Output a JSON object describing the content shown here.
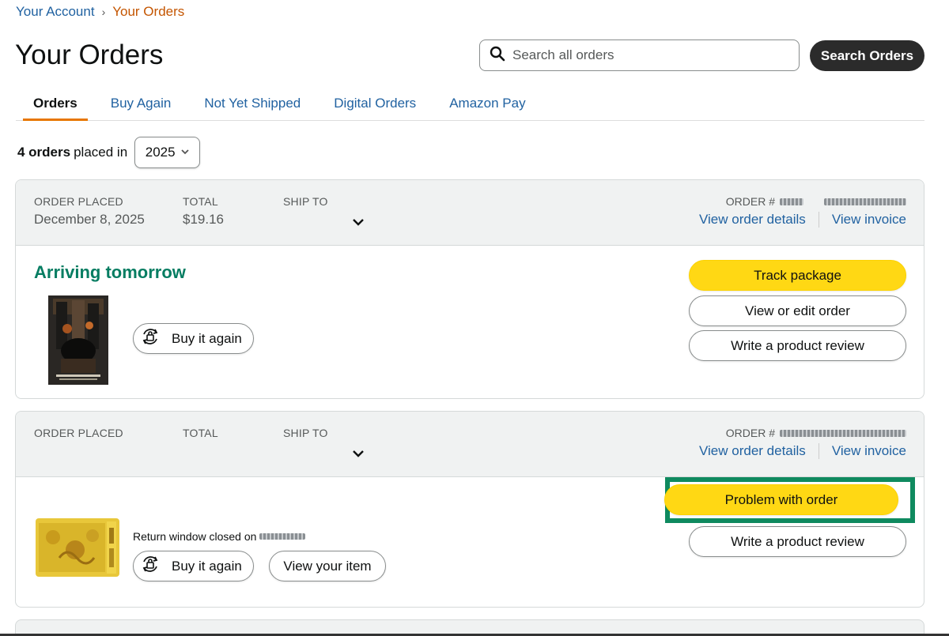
{
  "breadcrumb": {
    "account": "Your Account",
    "separator": "›",
    "current": "Your Orders"
  },
  "page_title": "Your Orders",
  "search": {
    "placeholder": "Search all orders",
    "value": "",
    "button_label": "Search Orders",
    "icon": "search-icon"
  },
  "tabs": [
    {
      "label": "Orders",
      "active": true
    },
    {
      "label": "Buy Again",
      "active": false
    },
    {
      "label": "Not Yet Shipped",
      "active": false
    },
    {
      "label": "Digital Orders",
      "active": false
    },
    {
      "label": "Amazon Pay",
      "active": false
    }
  ],
  "filter": {
    "count": "4 orders",
    "text": "placed in",
    "year": "2025"
  },
  "orders": [
    {
      "order_placed_label": "ORDER PLACED",
      "order_placed": "December 8, 2025",
      "total_label": "TOTAL",
      "total": "$19.16",
      "ship_to_label": "SHIP TO",
      "order_number_label": "ORDER #",
      "view_details": "View order details",
      "view_invoice": "View invoice",
      "status": "Arriving tomorrow",
      "buy_again": "Buy it again",
      "actions": [
        "Track package",
        "View or edit order",
        "Write a product review"
      ]
    },
    {
      "order_placed_label": "ORDER PLACED",
      "order_placed": "",
      "total_label": "TOTAL",
      "total": "",
      "ship_to_label": "SHIP TO",
      "order_number_label": "ORDER #",
      "view_details": "View order details",
      "view_invoice": "View invoice",
      "return_note": "Return window closed on",
      "buy_again": "Buy it again",
      "view_item": "View your item",
      "actions": [
        "Problem with order",
        "Write a product review"
      ]
    }
  ],
  "colors": {
    "link": "#2162a1",
    "status_green": "#067d62",
    "primary_button": "#ffd814",
    "tab_underline": "#e77600",
    "highlight_frame": "#0f8a5f",
    "search_button": "#2b2b2b"
  }
}
